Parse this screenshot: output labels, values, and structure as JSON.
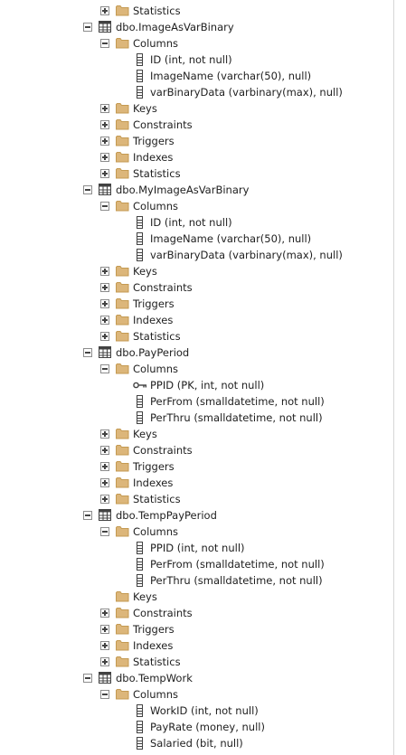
{
  "tree": [
    {
      "level": 1,
      "kind": "folder",
      "expander": "plus",
      "label": "Statistics"
    },
    {
      "level": 0,
      "kind": "table",
      "expander": "minus",
      "label": "dbo.ImageAsVarBinary"
    },
    {
      "level": 1,
      "kind": "folder",
      "expander": "minus",
      "label": "Columns"
    },
    {
      "level": 2,
      "kind": "column",
      "expander": "none",
      "label": "ID (int, not null)"
    },
    {
      "level": 2,
      "kind": "column",
      "expander": "none",
      "label": "ImageName (varchar(50), null)"
    },
    {
      "level": 2,
      "kind": "column",
      "expander": "none",
      "label": "varBinaryData (varbinary(max), null)"
    },
    {
      "level": 1,
      "kind": "folder",
      "expander": "plus",
      "label": "Keys"
    },
    {
      "level": 1,
      "kind": "folder",
      "expander": "plus",
      "label": "Constraints"
    },
    {
      "level": 1,
      "kind": "folder",
      "expander": "plus",
      "label": "Triggers"
    },
    {
      "level": 1,
      "kind": "folder",
      "expander": "plus",
      "label": "Indexes"
    },
    {
      "level": 1,
      "kind": "folder",
      "expander": "plus",
      "label": "Statistics"
    },
    {
      "level": 0,
      "kind": "table",
      "expander": "minus",
      "label": "dbo.MyImageAsVarBinary"
    },
    {
      "level": 1,
      "kind": "folder",
      "expander": "minus",
      "label": "Columns"
    },
    {
      "level": 2,
      "kind": "column",
      "expander": "none",
      "label": "ID (int, not null)"
    },
    {
      "level": 2,
      "kind": "column",
      "expander": "none",
      "label": "ImageName (varchar(50), null)"
    },
    {
      "level": 2,
      "kind": "column",
      "expander": "none",
      "label": "varBinaryData (varbinary(max), null)"
    },
    {
      "level": 1,
      "kind": "folder",
      "expander": "plus",
      "label": "Keys"
    },
    {
      "level": 1,
      "kind": "folder",
      "expander": "plus",
      "label": "Constraints"
    },
    {
      "level": 1,
      "kind": "folder",
      "expander": "plus",
      "label": "Triggers"
    },
    {
      "level": 1,
      "kind": "folder",
      "expander": "plus",
      "label": "Indexes"
    },
    {
      "level": 1,
      "kind": "folder",
      "expander": "plus",
      "label": "Statistics"
    },
    {
      "level": 0,
      "kind": "table",
      "expander": "minus",
      "label": "dbo.PayPeriod"
    },
    {
      "level": 1,
      "kind": "folder",
      "expander": "minus",
      "label": "Columns"
    },
    {
      "level": 2,
      "kind": "key",
      "expander": "none",
      "label": "PPID (PK, int, not null)"
    },
    {
      "level": 2,
      "kind": "column",
      "expander": "none",
      "label": "PerFrom (smalldatetime, not null)"
    },
    {
      "level": 2,
      "kind": "column",
      "expander": "none",
      "label": "PerThru (smalldatetime, not null)"
    },
    {
      "level": 1,
      "kind": "folder",
      "expander": "plus",
      "label": "Keys"
    },
    {
      "level": 1,
      "kind": "folder",
      "expander": "plus",
      "label": "Constraints"
    },
    {
      "level": 1,
      "kind": "folder",
      "expander": "plus",
      "label": "Triggers"
    },
    {
      "level": 1,
      "kind": "folder",
      "expander": "plus",
      "label": "Indexes"
    },
    {
      "level": 1,
      "kind": "folder",
      "expander": "plus",
      "label": "Statistics"
    },
    {
      "level": 0,
      "kind": "table",
      "expander": "minus",
      "label": "dbo.TempPayPeriod"
    },
    {
      "level": 1,
      "kind": "folder",
      "expander": "minus",
      "label": "Columns"
    },
    {
      "level": 2,
      "kind": "column",
      "expander": "none",
      "label": "PPID (int, not null)"
    },
    {
      "level": 2,
      "kind": "column",
      "expander": "none",
      "label": "PerFrom (smalldatetime, not null)"
    },
    {
      "level": 2,
      "kind": "column",
      "expander": "none",
      "label": "PerThru (smalldatetime, not null)"
    },
    {
      "level": 1,
      "kind": "folder",
      "expander": "none",
      "label": "Keys"
    },
    {
      "level": 1,
      "kind": "folder",
      "expander": "plus",
      "label": "Constraints"
    },
    {
      "level": 1,
      "kind": "folder",
      "expander": "plus",
      "label": "Triggers"
    },
    {
      "level": 1,
      "kind": "folder",
      "expander": "plus",
      "label": "Indexes"
    },
    {
      "level": 1,
      "kind": "folder",
      "expander": "plus",
      "label": "Statistics"
    },
    {
      "level": 0,
      "kind": "table",
      "expander": "minus",
      "label": "dbo.TempWork"
    },
    {
      "level": 1,
      "kind": "folder",
      "expander": "minus",
      "label": "Columns"
    },
    {
      "level": 2,
      "kind": "column",
      "expander": "none",
      "label": "WorkID (int, not null)"
    },
    {
      "level": 2,
      "kind": "column",
      "expander": "none",
      "label": "PayRate (money, null)"
    },
    {
      "level": 2,
      "kind": "column",
      "expander": "none",
      "label": "Salaried (bit, null)"
    }
  ],
  "colors": {
    "folder": "#dcb67a",
    "folder_edge": "#c49a52",
    "icon_stroke": "#424242",
    "expander_border": "#8c8c8c"
  }
}
